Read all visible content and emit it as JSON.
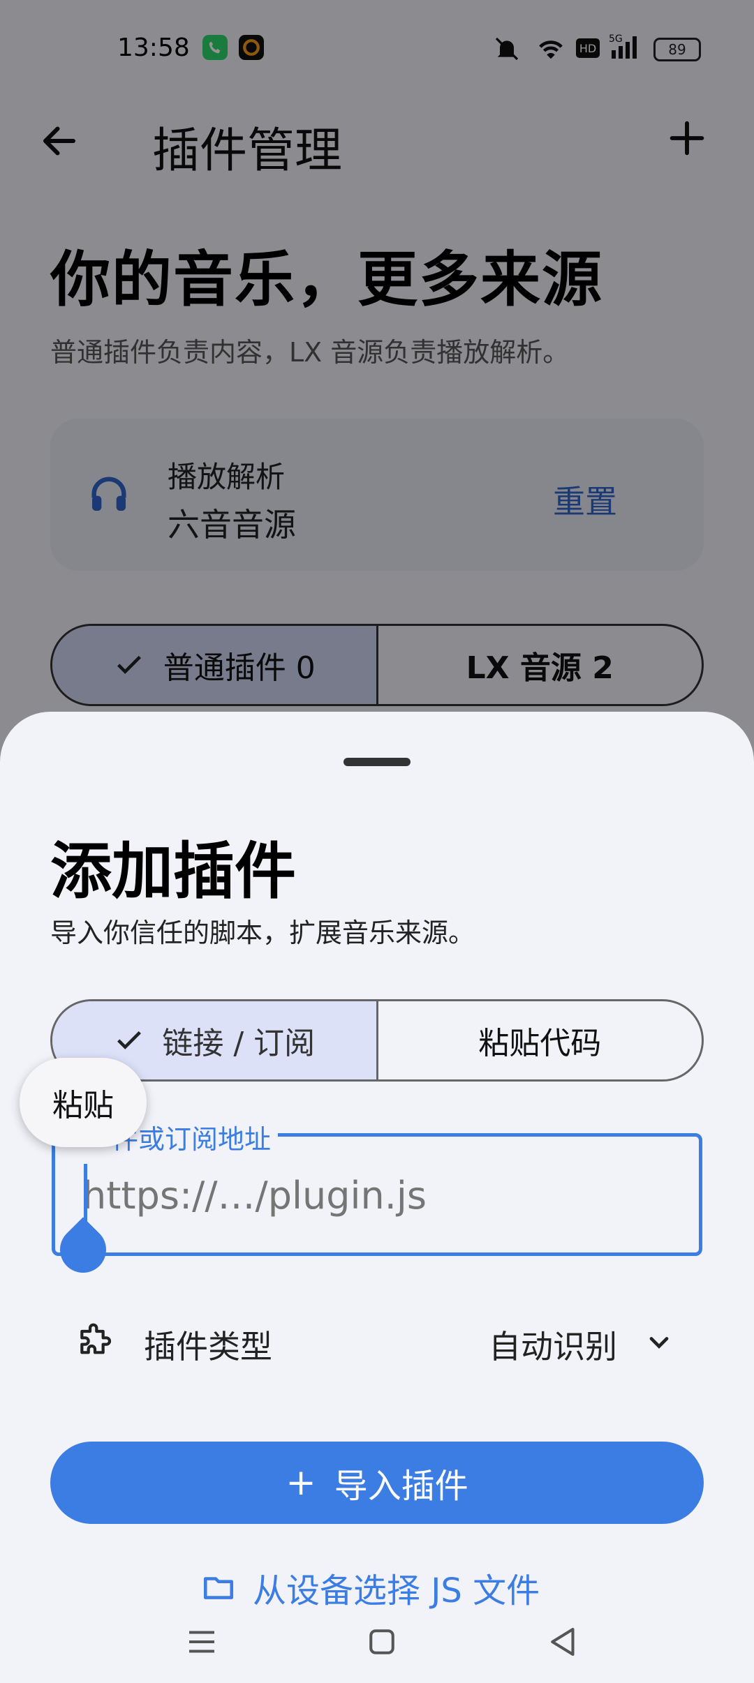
{
  "status_bar": {
    "time": "13:58",
    "battery": "89"
  },
  "header": {
    "title": "插件管理"
  },
  "hero": {
    "title": "你的音乐，更多来源",
    "subtitle": "普通插件负责内容，LX 音源负责播放解析。"
  },
  "playback_card": {
    "label": "播放解析",
    "value": "六音音源",
    "reset_label": "重置"
  },
  "plugin_tabs": [
    {
      "label": "普通插件 0",
      "selected": true
    },
    {
      "label": "LX 音源 2",
      "selected": false
    }
  ],
  "sheet": {
    "title": "添加插件",
    "subtitle": "导入你信任的脚本，扩展音乐来源。",
    "mode_tabs": [
      {
        "label": "链接 / 订阅",
        "selected": true
      },
      {
        "label": "粘贴代码",
        "selected": false
      }
    ],
    "paste_popup": "粘贴",
    "url_field": {
      "label": "件或订阅地址",
      "placeholder": "https://…/plugin.js",
      "value": ""
    },
    "type_row": {
      "label": "插件类型",
      "value": "自动识别"
    },
    "import_button": {
      "icon": "+",
      "label": "导入插件"
    },
    "file_link": "从设备选择 JS 文件"
  },
  "colors": {
    "accent": "#3c7de3",
    "link": "#2f63c9"
  }
}
